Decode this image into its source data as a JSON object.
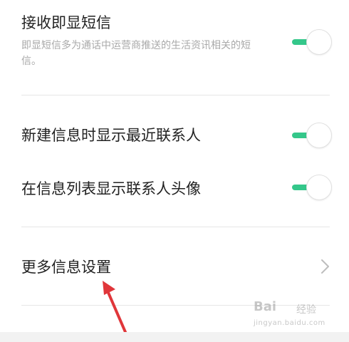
{
  "settings": {
    "instant_sms": {
      "title": "接收即显短信",
      "description": "即显短信多为通话中运营商推送的生活资讯相关的短信。",
      "enabled": true
    },
    "show_recent_contacts": {
      "title": "新建信息时显示最近联系人",
      "enabled": true
    },
    "show_contact_avatars": {
      "title": "在信息列表显示联系人头像",
      "enabled": true
    },
    "more_settings": {
      "title": "更多信息设置"
    }
  },
  "watermark": {
    "brand": "Bai",
    "brand_tail": "经验",
    "sub": "jingyan.baidu.com"
  },
  "colors": {
    "toggle_on": "#34c78a",
    "annotation_arrow": "#e0363a"
  },
  "icons": {
    "toggle": "toggle-switch-on",
    "chevron": "chevron-right-icon",
    "arrow": "annotation-arrow"
  }
}
